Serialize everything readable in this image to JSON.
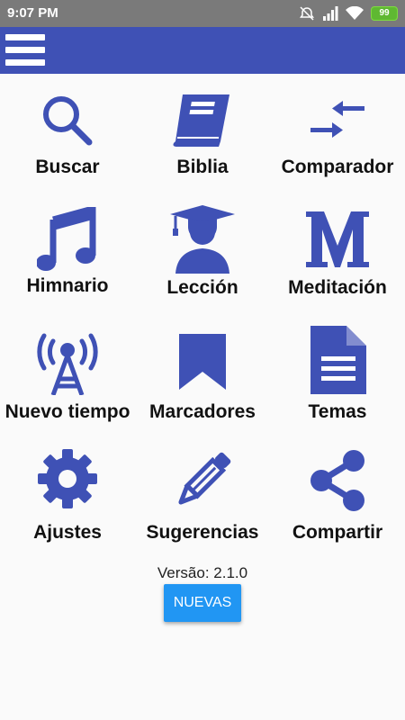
{
  "status_bar": {
    "time": "9:07 PM",
    "battery": "99",
    "icons": [
      "mute-alarm-icon",
      "signal-icon",
      "wifi-icon",
      "battery-icon"
    ]
  },
  "app_bar": {
    "menu_icon": "hamburger-menu-icon",
    "color": "#3f51b5"
  },
  "menu": {
    "icon_color": "#3f51b5",
    "items": [
      {
        "label": "Buscar",
        "icon": "search-icon"
      },
      {
        "label": "Biblia",
        "icon": "book-icon"
      },
      {
        "label": "Comparador",
        "icon": "compare-arrows-icon"
      },
      {
        "label": "Himnario",
        "icon": "music-note-icon"
      },
      {
        "label": "Lección",
        "icon": "graduate-icon"
      },
      {
        "label": "Meditación",
        "icon": "letter-m-icon"
      },
      {
        "label": "Nuevo tiempo",
        "icon": "radio-tower-icon"
      },
      {
        "label": "Marcadores",
        "icon": "bookmark-icon"
      },
      {
        "label": "Temas",
        "icon": "document-icon"
      },
      {
        "label": "Ajustes",
        "icon": "gear-icon"
      },
      {
        "label": "Sugerencias",
        "icon": "pencil-icon"
      },
      {
        "label": "Compartir",
        "icon": "share-icon"
      }
    ]
  },
  "footer": {
    "version": "Versão: 2.1.0",
    "button_label": "NUEVAS",
    "button_color": "#2196f3"
  }
}
